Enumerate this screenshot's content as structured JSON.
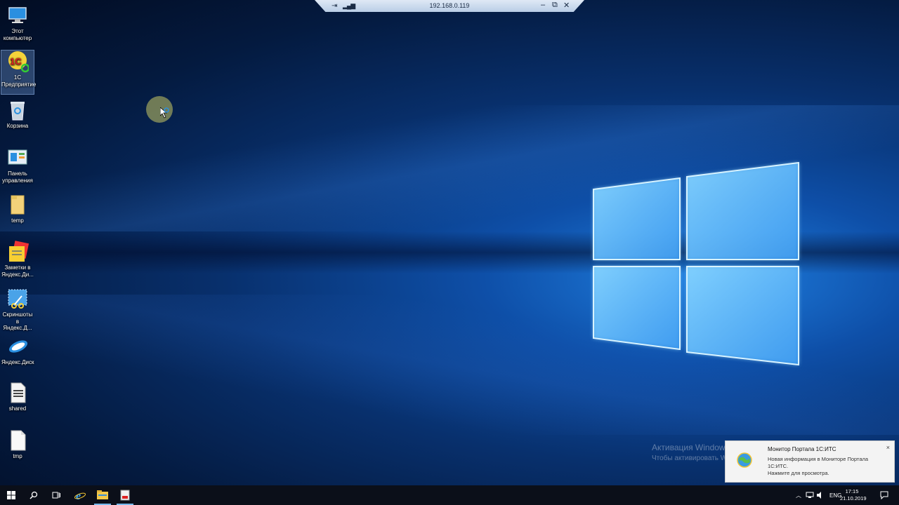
{
  "rdp": {
    "ip": "192.168.0.119",
    "minimize": "‒",
    "restore": "⧉",
    "close": "✕"
  },
  "desktop_icons": [
    {
      "label": "Этот компьютер",
      "icon": "computer-icon"
    },
    {
      "label": "1С Предприятие",
      "icon": "1c-enterprise-icon",
      "selected": true
    },
    {
      "label": "Корзина",
      "icon": "recycle-bin-icon"
    },
    {
      "label": "Панель управления",
      "icon": "control-panel-icon"
    },
    {
      "label": "temp",
      "icon": "folder-icon"
    },
    {
      "label": "Заметки в Яндекс.Ди...",
      "icon": "yandex-notes-icon"
    },
    {
      "label": "Скриншоты в Яндекс.Д...",
      "icon": "yandex-screenshots-icon"
    },
    {
      "label": "Яндекс.Диск",
      "icon": "yandex-disk-icon"
    },
    {
      "label": "shared",
      "icon": "document-icon"
    },
    {
      "label": "tmp",
      "icon": "blank-file-icon"
    }
  ],
  "activation": {
    "title": "Активация Windows",
    "subtitle": "Чтобы активировать Windows, перейдите в раздел"
  },
  "toast": {
    "title": "Монитор Портала 1С:ИТС",
    "body": "Новая информация в Мониторе Портала 1С:ИТС.",
    "hint": "Нажмите для просмотра.",
    "close": "×"
  },
  "taskbar": {
    "pinned": [
      "start-icon",
      "search-icon",
      "task-view-icon",
      "internet-explorer-icon",
      "file-explorer-icon",
      "app-icon"
    ],
    "language": "ENG",
    "time": "17:15",
    "date": "21.10.2019"
  },
  "colors": {
    "accent": "#76b9ed",
    "taskbar": "#0b0f19",
    "desktop": "#08306d"
  }
}
